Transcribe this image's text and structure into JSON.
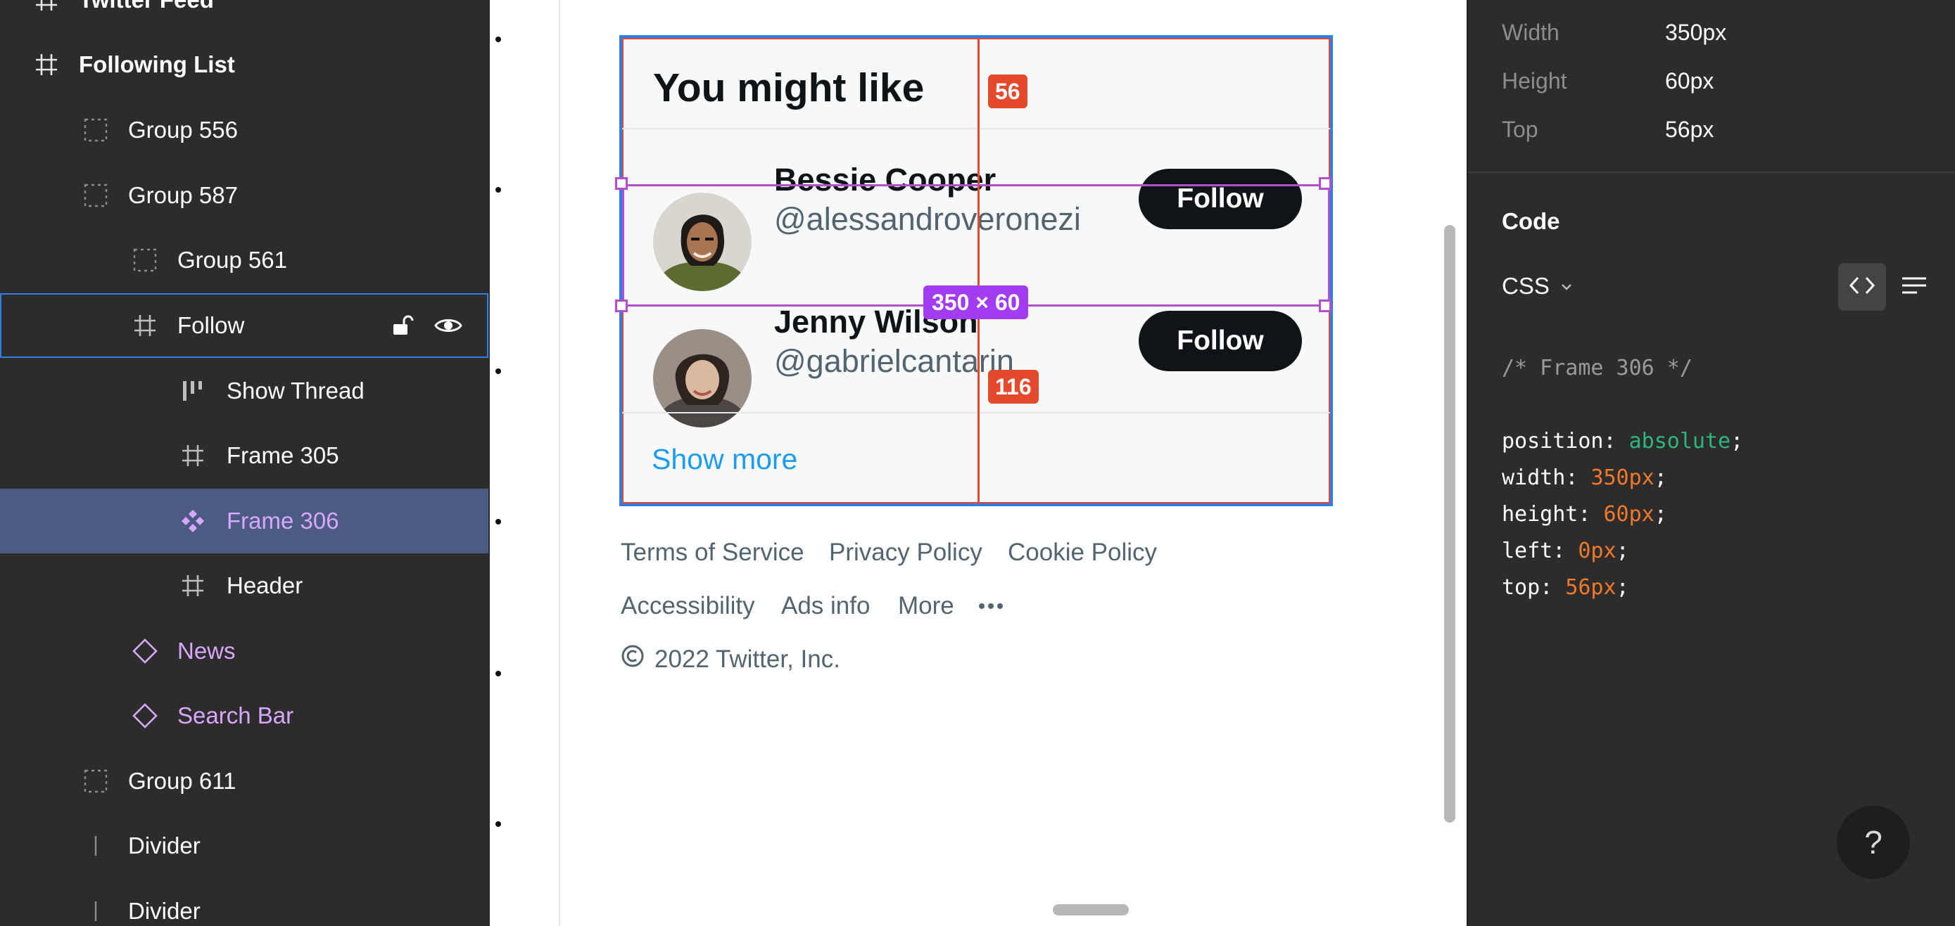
{
  "layers": {
    "items": [
      {
        "label": "Twitter Feed",
        "icon": "frame-icon"
      },
      {
        "label": "Following List",
        "icon": "frame-icon"
      },
      {
        "label": "Group 556",
        "icon": "group-icon"
      },
      {
        "label": "Group 587",
        "icon": "group-icon"
      },
      {
        "label": "Group 561",
        "icon": "group-icon"
      },
      {
        "label": "Follow",
        "icon": "frame-icon"
      },
      {
        "label": "Show Thread",
        "icon": "auto-layout-icon"
      },
      {
        "label": "Frame 305",
        "icon": "frame-icon"
      },
      {
        "label": "Frame 306",
        "icon": "component-icon"
      },
      {
        "label": "Header",
        "icon": "frame-icon"
      },
      {
        "label": "News",
        "icon": "instance-icon"
      },
      {
        "label": "Search Bar",
        "icon": "instance-icon"
      },
      {
        "label": "Group 611",
        "icon": "group-icon"
      },
      {
        "label": "Divider",
        "icon": "line-icon"
      },
      {
        "label": "Divider",
        "icon": "line-icon"
      }
    ]
  },
  "canvas": {
    "card": {
      "title": "You might like",
      "users": [
        {
          "name": "Bessie Cooper",
          "handle": "@alessandroveronezi",
          "button": "Follow"
        },
        {
          "name": "Jenny Wilson",
          "handle": "@gabrielcantarin",
          "button": "Follow"
        }
      ],
      "show_more": "Show more"
    },
    "measure": {
      "top_offset": "56",
      "bottom_offset": "116",
      "size": "350 × 60"
    },
    "footer": {
      "links_row1": [
        "Terms of Service",
        "Privacy Policy",
        "Cookie Policy"
      ],
      "links_row2": [
        "Accessibility",
        "Ads info",
        "More"
      ],
      "more_icon": "ellipsis-icon",
      "copyright": "2022 Twitter, Inc."
    }
  },
  "inspector": {
    "props": [
      {
        "label": "Width",
        "value": "350px"
      },
      {
        "label": "Height",
        "value": "60px"
      },
      {
        "label": "Top",
        "value": "56px"
      }
    ],
    "code_title": "Code",
    "language": "CSS",
    "code": {
      "comment": "/* Frame 306 */",
      "lines": [
        {
          "prop": "position",
          "value": "absolute",
          "kind": "keyword"
        },
        {
          "prop": "width",
          "value": "350px",
          "kind": "number"
        },
        {
          "prop": "height",
          "value": "60px",
          "kind": "number"
        },
        {
          "prop": "left",
          "value": "0px",
          "kind": "number"
        },
        {
          "prop": "top",
          "value": "56px",
          "kind": "number"
        }
      ]
    },
    "help": "?"
  },
  "colors": {
    "panel_bg": "#2c2c2c",
    "selection": "#4b5b82",
    "component": "#d9a7ff",
    "accent_blue": "#2d7ee6",
    "measure_red": "#e5492b",
    "size_purple": "#a33cf0",
    "twitter_blue": "#1d9bf0",
    "code_keyword": "#2fb67c",
    "code_number": "#f07a2a"
  }
}
